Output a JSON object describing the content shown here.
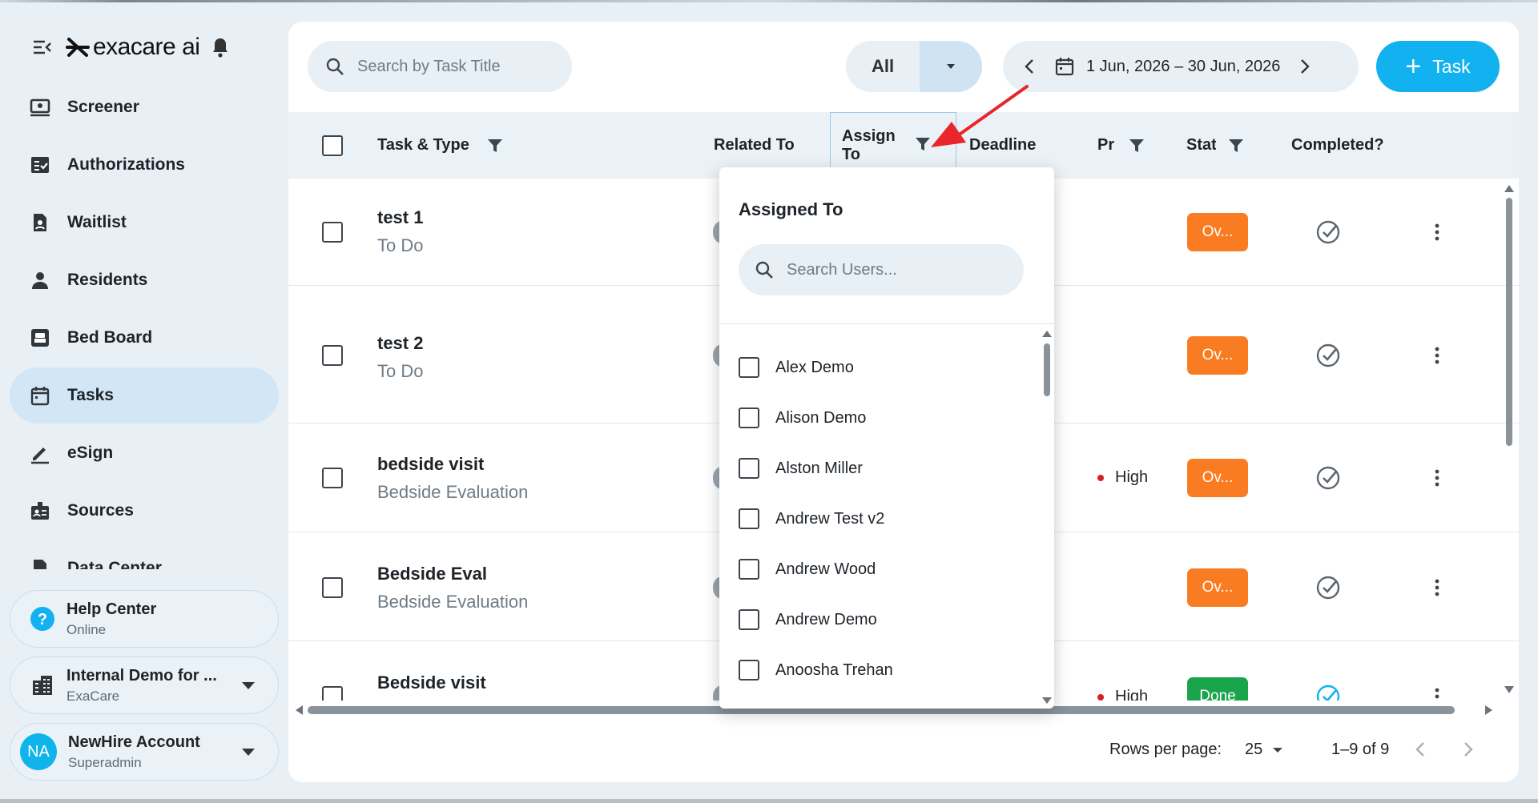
{
  "brand": {
    "name": "exacare ai"
  },
  "sidebar": {
    "items": [
      {
        "label": "Screener",
        "icon": "screener-icon"
      },
      {
        "label": "Authorizations",
        "icon": "authorizations-icon"
      },
      {
        "label": "Waitlist",
        "icon": "waitlist-icon"
      },
      {
        "label": "Residents",
        "icon": "person-icon"
      },
      {
        "label": "Bed Board",
        "icon": "bed-icon"
      },
      {
        "label": "Tasks",
        "icon": "calendar-icon",
        "active": true
      },
      {
        "label": "eSign",
        "icon": "pen-icon"
      },
      {
        "label": "Sources",
        "icon": "badge-icon"
      },
      {
        "label": "Data Center",
        "icon": "data-icon"
      }
    ],
    "help": {
      "title": "Help Center",
      "status": "Online"
    },
    "org": {
      "title": "Internal Demo for ...",
      "sub": "ExaCare"
    },
    "account": {
      "initials": "NA",
      "title": "NewHire Account",
      "role": "Superadmin"
    }
  },
  "toolbar": {
    "search_placeholder": "Search by Task Title",
    "filter_value": "All",
    "date_range": "1 Jun, 2026 – 30 Jun, 2026",
    "add_label": "Task"
  },
  "table": {
    "headers": {
      "task": "Task & Type",
      "related": "Related To",
      "assign": "Assign To",
      "deadline": "Deadline",
      "priority": "Pr",
      "status": "Stat",
      "completed": "Completed?"
    },
    "rows": [
      {
        "title": "test 1",
        "type": "To Do",
        "priority": "",
        "status": "Ov...",
        "status_kind": "overdue"
      },
      {
        "title": "test 2",
        "type": "To Do",
        "priority": "",
        "status": "Ov...",
        "status_kind": "overdue"
      },
      {
        "title": "bedside visit",
        "type": "Bedside Evaluation",
        "priority": "High",
        "status": "Ov...",
        "status_kind": "overdue"
      },
      {
        "title": "Bedside Eval",
        "type": "Bedside Evaluation",
        "priority": "",
        "status": "Ov...",
        "status_kind": "overdue"
      },
      {
        "title": "Bedside visit",
        "type": "",
        "priority": "High",
        "status": "Done",
        "status_kind": "done"
      }
    ]
  },
  "pagination": {
    "rows_label": "Rows per page:",
    "rows_value": "25",
    "range": "1–9 of 9"
  },
  "popup": {
    "title": "Assigned To",
    "search_placeholder": "Search Users...",
    "users": [
      "Alex Demo",
      "Alison Demo",
      "Alston Miller",
      "Andrew Test v2",
      "Andrew Wood",
      "Andrew Demo",
      "Anoosha Trehan"
    ]
  },
  "colors": {
    "accent": "#12b1ef",
    "overdue": "#fa7c22",
    "done": "#1aa44c",
    "active_nav": "#d3e6f5",
    "annotation": "#e8262b"
  }
}
